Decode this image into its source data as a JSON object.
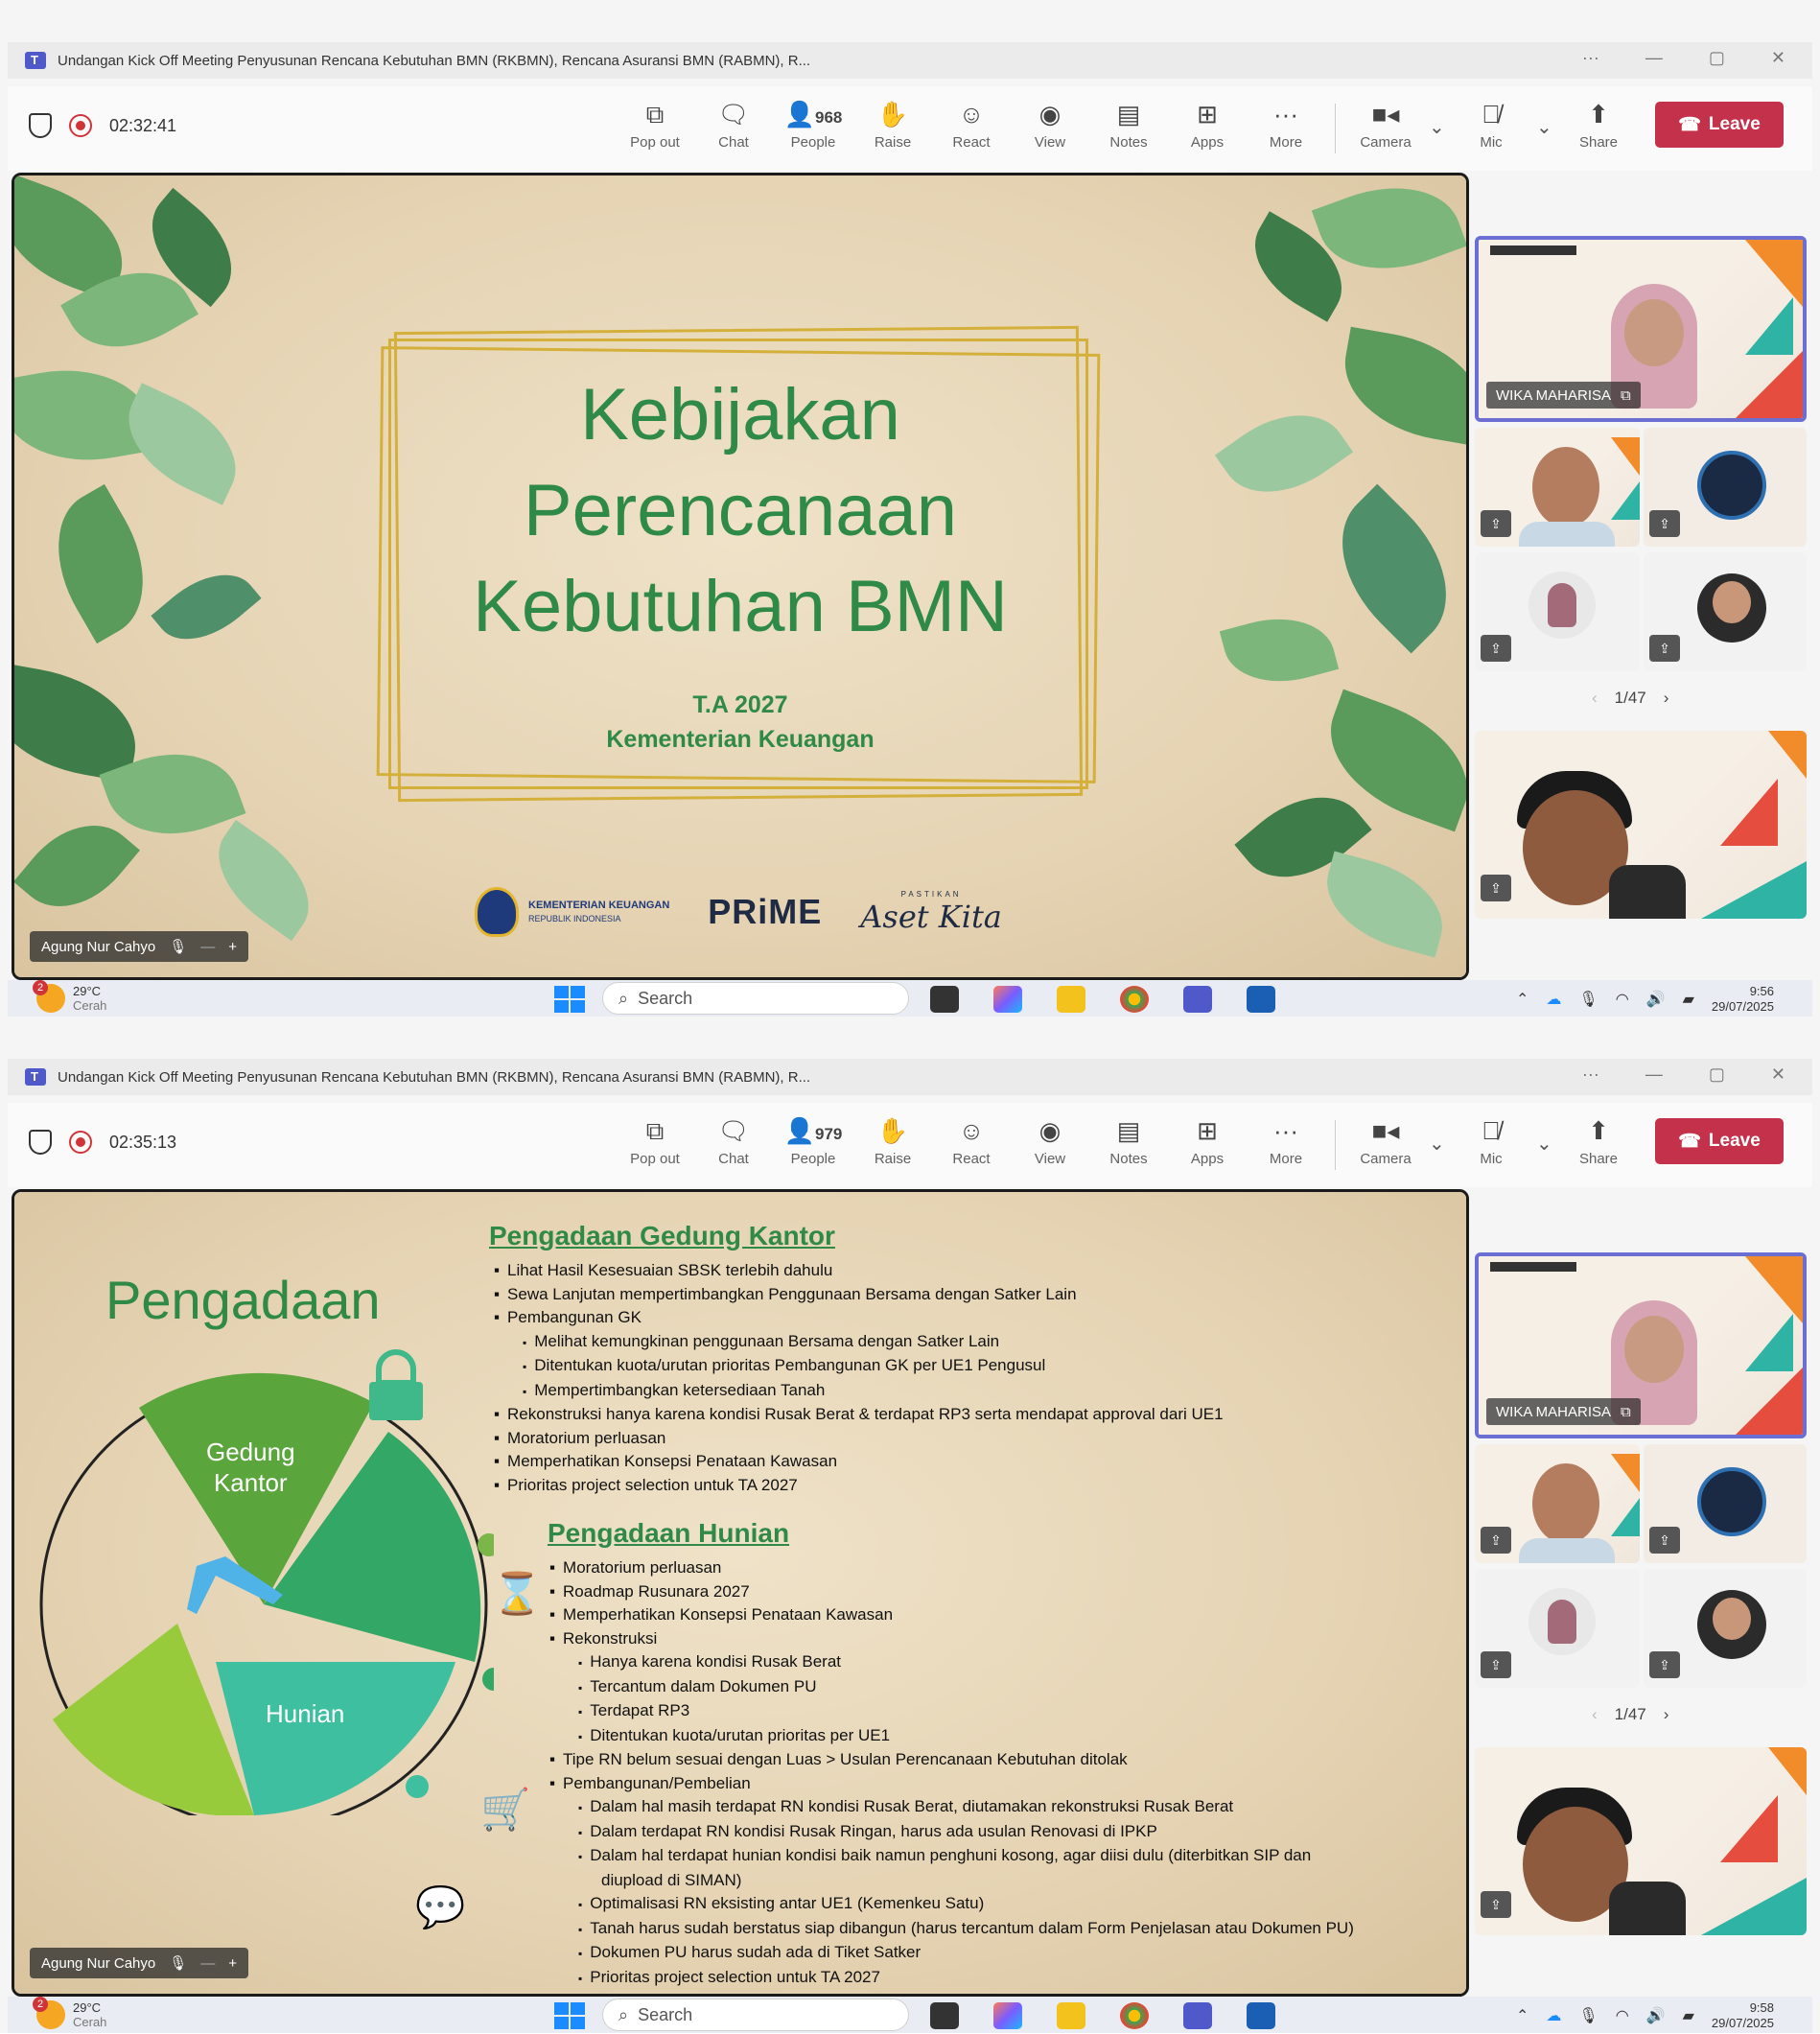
{
  "meeting_title": "Undangan Kick Off Meeting Penyusunan Rencana Kebutuhan BMN (RKBMN), Rencana Asuransi BMN (RABMN), R...",
  "toolbar": {
    "popout": "Pop out",
    "chat": "Chat",
    "people": "People",
    "raise": "Raise",
    "react": "React",
    "view": "View",
    "notes": "Notes",
    "apps": "Apps",
    "more": "More",
    "camera": "Camera",
    "mic": "Mic",
    "share": "Share",
    "leave": "Leave"
  },
  "shot1": {
    "timer": "02:32:41",
    "people_count": "968",
    "pager": "1/47",
    "clock_time": "9:56",
    "clock_date": "29/07/2025"
  },
  "shot2": {
    "timer": "02:35:13",
    "people_count": "979",
    "pager": "1/47",
    "clock_time": "9:58",
    "clock_date": "29/07/2025"
  },
  "presenter": "Agung Nur Cahyo",
  "active_speaker": "WIKA MAHARISA",
  "taskbar": {
    "temp": "29°C",
    "weather": "Cerah",
    "search": "Search",
    "badge": "2"
  },
  "slide1": {
    "title_lines": [
      "Kebijakan",
      "Perencanaan",
      "Kebutuhan BMN"
    ],
    "year": "T.A 2027",
    "org": "Kementerian Keuangan",
    "logo_kemenkeu": "KEMENTERIAN KEUANGAN",
    "logo_kemenkeu_sub": "REPUBLIK INDONESIA",
    "logo_prime": "PRiME",
    "logo_aset": "Aset Kita",
    "logo_aset_top": "PASTIKAN"
  },
  "slide2": {
    "title": "Pengadaan",
    "wheel_labels": {
      "gedung": "Gedung\nKantor",
      "hunian": "Hunian"
    },
    "section1_title": "Pengadaan Gedung Kantor",
    "section1_items": [
      {
        "lvl": 1,
        "text": "Lihat Hasil Kesesuaian SBSK terlebih dahulu"
      },
      {
        "lvl": 1,
        "text": "Sewa Lanjutan mempertimbangkan Penggunaan Bersama dengan Satker Lain"
      },
      {
        "lvl": 1,
        "text": "Pembangunan GK"
      },
      {
        "lvl": 2,
        "text": "Melihat kemungkinan penggunaan Bersama dengan Satker Lain"
      },
      {
        "lvl": 2,
        "text": "Ditentukan kuota/urutan prioritas Pembangunan GK per UE1 Pengusul"
      },
      {
        "lvl": 2,
        "text": "Mempertimbangkan ketersediaan Tanah"
      },
      {
        "lvl": 1,
        "text": "Rekonstruksi hanya karena kondisi Rusak Berat & terdapat RP3 serta mendapat approval dari UE1"
      },
      {
        "lvl": 1,
        "text": "Moratorium perluasan"
      },
      {
        "lvl": 1,
        "text": "Memperhatikan Konsepsi Penataan Kawasan"
      },
      {
        "lvl": 1,
        "text": "Prioritas project selection untuk TA 2027"
      }
    ],
    "section2_title": "Pengadaan Hunian",
    "section2_items": [
      {
        "lvl": 1,
        "text": "Moratorium perluasan"
      },
      {
        "lvl": 1,
        "text": "Roadmap Rusunara 2027"
      },
      {
        "lvl": 1,
        "text": "Memperhatikan Konsepsi Penataan Kawasan"
      },
      {
        "lvl": 1,
        "text": "Rekonstruksi"
      },
      {
        "lvl": 2,
        "text": "Hanya karena kondisi Rusak Berat"
      },
      {
        "lvl": 2,
        "text": "Tercantum dalam Dokumen PU"
      },
      {
        "lvl": 2,
        "text": "Terdapat RP3"
      },
      {
        "lvl": 2,
        "text": "Ditentukan kuota/urutan prioritas per UE1"
      },
      {
        "lvl": 1,
        "text": "Tipe RN belum sesuai dengan Luas > Usulan Perencanaan Kebutuhan ditolak"
      },
      {
        "lvl": 1,
        "text": "Pembangunan/Pembelian"
      },
      {
        "lvl": 2,
        "text": "Dalam hal masih terdapat RN kondisi Rusak Berat, diutamakan rekonstruksi Rusak Berat"
      },
      {
        "lvl": 2,
        "text": "Dalam terdapat RN kondisi Rusak Ringan, harus ada usulan Renovasi di IPKP"
      },
      {
        "lvl": 2,
        "text": "Dalam hal terdapat hunian kondisi baik namun penghuni kosong, agar diisi dulu (diterbitkan SIP dan"
      },
      {
        "lvl": 3,
        "text": "diupload  di SIMAN)"
      },
      {
        "lvl": 2,
        "text": "Optimalisasi RN eksisting antar UE1 (Kemenkeu Satu)"
      },
      {
        "lvl": 2,
        "text": "Tanah harus sudah berstatus siap dibangun (harus tercantum dalam Form Penjelasan atau Dokumen PU)"
      },
      {
        "lvl": 2,
        "text": "Dokumen PU harus sudah ada di Tiket Satker"
      },
      {
        "lvl": 2,
        "text": "Prioritas project selection untuk TA 2027"
      }
    ]
  },
  "colors": {
    "leave": "#c4314b",
    "slide_green": "#2f8a47",
    "active_tile": "#6b6fd4",
    "frame_gold": "#d4b03a"
  },
  "icons": [
    "teams-icon",
    "shield-icon",
    "record-icon",
    "popout-icon",
    "chat-icon",
    "people-icon",
    "hand-icon",
    "smile-icon",
    "view-icon",
    "notes-icon",
    "apps-icon",
    "more-icon",
    "camera-icon",
    "mic-off-icon",
    "share-icon",
    "phone-icon",
    "pin-icon",
    "search-icon",
    "windows-icon"
  ]
}
